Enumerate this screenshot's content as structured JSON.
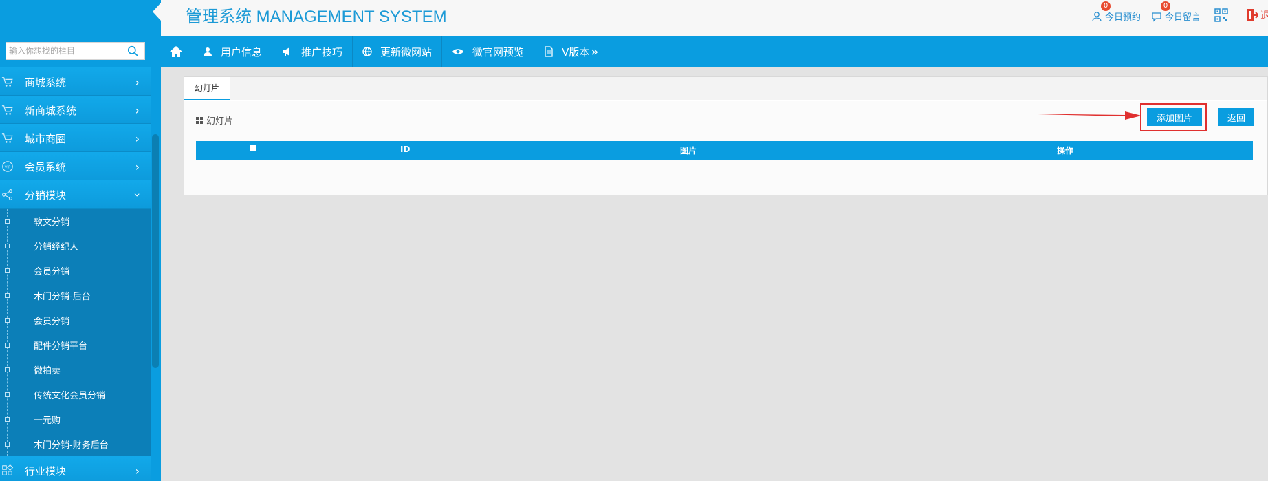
{
  "header": {
    "title": "管理系统 MANAGEMENT SYSTEM",
    "appointments_label": "今日预约",
    "appointments_count": "0",
    "messages_label": "今日留言",
    "messages_count": "0",
    "logout_label": "退"
  },
  "sidebar": {
    "search_placeholder": "输入你想找的栏目",
    "menu": [
      {
        "label": "商城系统",
        "icon": "cart-icon"
      },
      {
        "label": "新商城系统",
        "icon": "cart-icon"
      },
      {
        "label": "城市商圈",
        "icon": "cart-icon"
      },
      {
        "label": "会员系统",
        "icon": "vip-icon"
      },
      {
        "label": "分销模块",
        "icon": "share-icon"
      }
    ],
    "submenu": [
      "软文分销",
      "分销经纪人",
      "会员分销",
      "木门分销-后台",
      "会员分销",
      "配件分销平台",
      "微拍卖",
      "传统文化会员分销",
      "一元购",
      "木门分销-财务后台"
    ],
    "bottom_menu": {
      "label": "行业模块",
      "icon": "grid-icon"
    }
  },
  "navbar": {
    "items": [
      "用户信息",
      "推广技巧",
      "更新微网站",
      "微官网预览",
      "V版本"
    ]
  },
  "content": {
    "tab_label": "幻灯片",
    "section_title": "幻灯片",
    "add_button": "添加图片",
    "back_button": "返回",
    "table_headers": [
      "ID",
      "图片",
      "操作"
    ]
  },
  "colors": {
    "primary": "#0a9de0",
    "sidebar_sub": "#0c7fb8",
    "highlight": "#e0302f",
    "title": "#1c9ad6"
  }
}
